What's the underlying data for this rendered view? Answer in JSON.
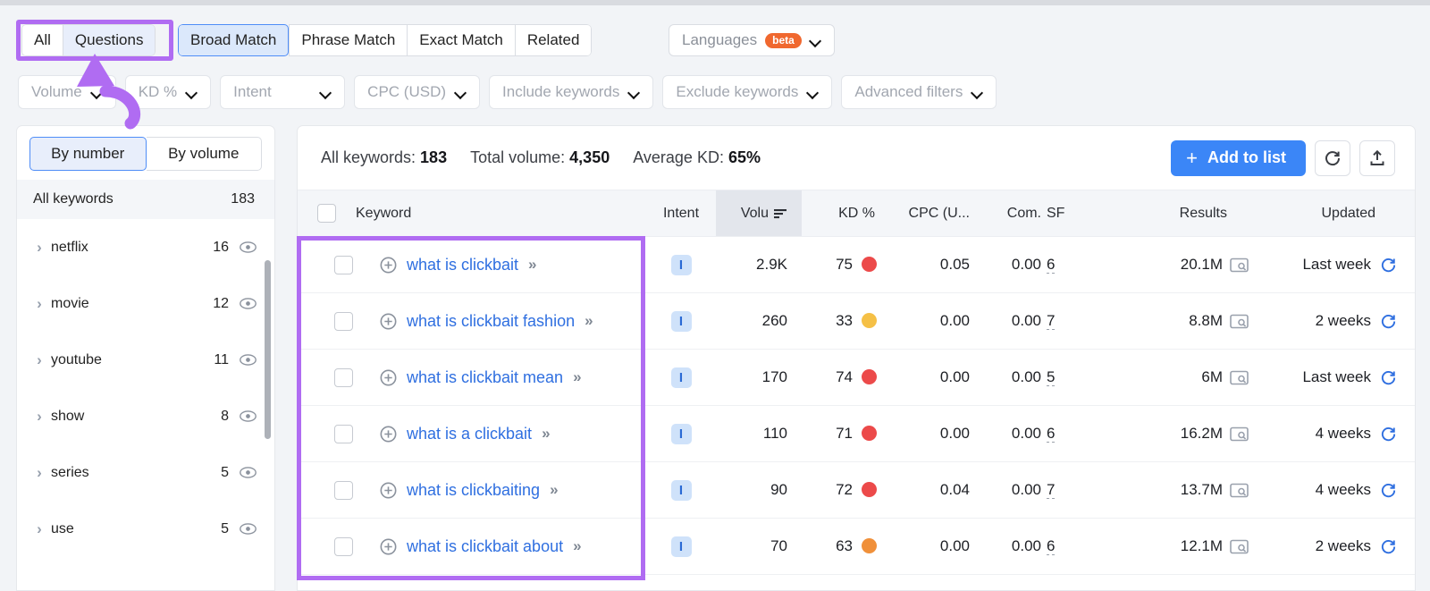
{
  "colors": {
    "highlight_purple": "#b06cf2",
    "accent_blue": "#3b86f7",
    "link_blue": "#2f6fe0",
    "beta_orange": "#f0682f",
    "kd_red": "#ec4a4a",
    "kd_orange": "#f0903a",
    "kd_yellow": "#f5c046"
  },
  "toolbar": {
    "scope_tabs": [
      {
        "label": "All",
        "selected": false
      },
      {
        "label": "Questions",
        "selected": true
      }
    ],
    "match_tabs": [
      {
        "label": "Broad Match",
        "selected": true
      },
      {
        "label": "Phrase Match",
        "selected": false
      },
      {
        "label": "Exact Match",
        "selected": false
      },
      {
        "label": "Related",
        "selected": false
      }
    ],
    "languages": {
      "label": "Languages",
      "badge": "beta"
    }
  },
  "filters": [
    {
      "label": "Volume"
    },
    {
      "label": "KD %"
    },
    {
      "label": "Intent"
    },
    {
      "label": "CPC (USD)"
    },
    {
      "label": "Include keywords"
    },
    {
      "label": "Exclude keywords"
    },
    {
      "label": "Advanced filters"
    }
  ],
  "sidebar": {
    "segments": [
      {
        "label": "By number",
        "selected": true
      },
      {
        "label": "By volume",
        "selected": false
      }
    ],
    "all_keywords": {
      "label": "All keywords",
      "count": "183"
    },
    "groups": [
      {
        "label": "netflix",
        "count": "16"
      },
      {
        "label": "movie",
        "count": "12"
      },
      {
        "label": "youtube",
        "count": "11"
      },
      {
        "label": "show",
        "count": "8"
      },
      {
        "label": "series",
        "count": "5"
      },
      {
        "label": "use",
        "count": "5"
      }
    ]
  },
  "main": {
    "stats": [
      {
        "label": "All keywords:",
        "value": "183"
      },
      {
        "label": "Total volume:",
        "value": "4,350"
      },
      {
        "label": "Average KD:",
        "value": "65%"
      }
    ],
    "add_to_list": "Add to list",
    "plus_sign": "+",
    "columns": [
      "Keyword",
      "Intent",
      "Volu",
      "KD %",
      "CPC (U...",
      "Com.",
      "SF",
      "Results",
      "Updated"
    ],
    "rows": [
      {
        "keyword": "what is clickbait",
        "intent": "I",
        "volume": "2.9K",
        "kd": "75",
        "kd_color": "#ec4a4a",
        "cpc": "0.05",
        "com": "0.00",
        "sf": "6",
        "results": "20.1M",
        "updated": "Last week"
      },
      {
        "keyword": "what is clickbait fashion",
        "intent": "I",
        "volume": "260",
        "kd": "33",
        "kd_color": "#f5c046",
        "cpc": "0.00",
        "com": "0.00",
        "sf": "7",
        "results": "8.8M",
        "updated": "2 weeks"
      },
      {
        "keyword": "what is clickbait mean",
        "intent": "I",
        "volume": "170",
        "kd": "74",
        "kd_color": "#ec4a4a",
        "cpc": "0.00",
        "com": "0.00",
        "sf": "5",
        "results": "6M",
        "updated": "Last week"
      },
      {
        "keyword": "what is a clickbait",
        "intent": "I",
        "volume": "110",
        "kd": "71",
        "kd_color": "#ec4a4a",
        "cpc": "0.00",
        "com": "0.00",
        "sf": "6",
        "results": "16.2M",
        "updated": "4 weeks"
      },
      {
        "keyword": "what is clickbaiting",
        "intent": "I",
        "volume": "90",
        "kd": "72",
        "kd_color": "#ec4a4a",
        "cpc": "0.04",
        "com": "0.00",
        "sf": "7",
        "results": "13.7M",
        "updated": "4 weeks"
      },
      {
        "keyword": "what is clickbait about",
        "intent": "I",
        "volume": "70",
        "kd": "63",
        "kd_color": "#f0903a",
        "cpc": "0.00",
        "com": "0.00",
        "sf": "6",
        "results": "12.1M",
        "updated": "2 weeks"
      }
    ],
    "row_expand_glyph": "»"
  }
}
